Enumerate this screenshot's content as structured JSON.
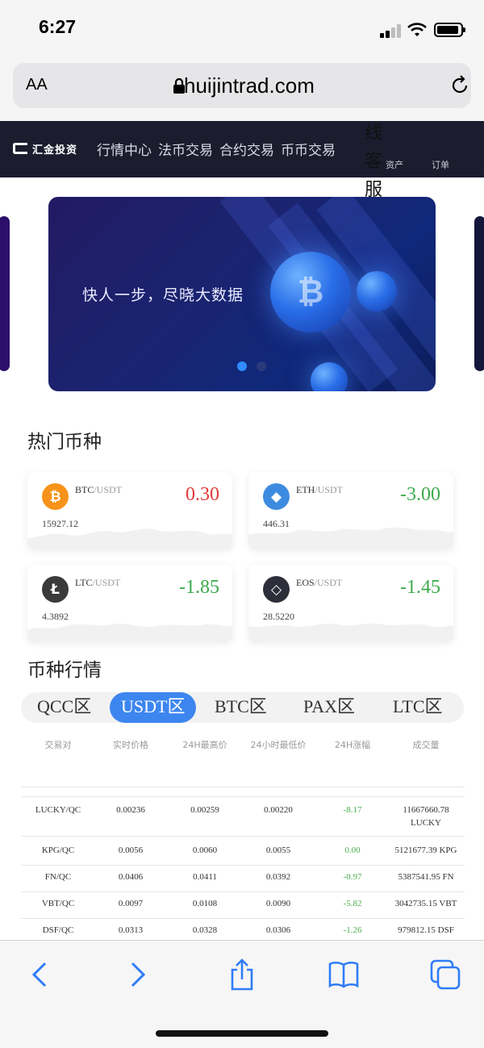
{
  "status_bar": {
    "time": "6:27"
  },
  "browser": {
    "text_size_label": "AA",
    "url": "huijintrad.com"
  },
  "site_header": {
    "logo_text": "汇金投资",
    "nav": [
      "行情中心",
      "法币交易",
      "合约交易",
      "币币交易"
    ],
    "nav_overflow_chars": [
      "线",
      "客",
      "服"
    ],
    "assets_label": "资产",
    "orders_label": "订单"
  },
  "banner": {
    "slogan": "快人一步，尽晓大数据",
    "slide_count": 2,
    "active_slide": 1
  },
  "hot": {
    "title": "热门币种",
    "cards": [
      {
        "base": "BTC",
        "quote": "/USDT",
        "change": "0.30",
        "price": "15927.12",
        "trend": "up",
        "icon": "bitcoin-icon",
        "icon_color": "#f7931a",
        "glyph": "₿"
      },
      {
        "base": "ETH",
        "quote": "/USDT",
        "change": "-3.00",
        "price": "446.31",
        "trend": "down",
        "icon": "ethereum-icon",
        "icon_color": "#3d8be0",
        "glyph": "◆"
      },
      {
        "base": "LTC",
        "quote": "/USDT",
        "change": "-1.85",
        "price": "4.3892",
        "trend": "down",
        "icon": "litecoin-icon",
        "icon_color": "#3a3a3a",
        "glyph": "Ł"
      },
      {
        "base": "EOS",
        "quote": "/USDT",
        "change": "-1.45",
        "price": "28.5220",
        "trend": "down",
        "icon": "eos-icon",
        "icon_color": "#2e2e3a",
        "glyph": "◇"
      }
    ]
  },
  "market": {
    "title": "币种行情",
    "tabs": [
      "QCC区",
      "USDT区",
      "BTC区",
      "PAX区",
      "LTC区"
    ],
    "active_tab": "USDT区",
    "columns": [
      "交易对",
      "实时价格",
      "24H最高价",
      "24小时最低价",
      "24H涨幅",
      "成交量"
    ],
    "rows": [
      {
        "pair": "LUCKY/QC",
        "price": "0.00236",
        "high": "0.00259",
        "low": "0.00220",
        "change": "-8.17",
        "volume": "11667660.78 LUCKY"
      },
      {
        "pair": "KPG/QC",
        "price": "0.0056",
        "high": "0.0060",
        "low": "0.0055",
        "change": "0.00",
        "volume": "5121677.39 KPG"
      },
      {
        "pair": "FN/QC",
        "price": "0.0406",
        "high": "0.0411",
        "low": "0.0392",
        "change": "-0.97",
        "volume": "5387541.95 FN"
      },
      {
        "pair": "VBT/QC",
        "price": "0.0097",
        "high": "0.0108",
        "low": "0.0090",
        "change": "-5.82",
        "volume": "3042735.15 VBT"
      },
      {
        "pair": "DSF/QC",
        "price": "0.0313",
        "high": "0.0328",
        "low": "0.0306",
        "change": "-1.26",
        "volume": "979812.15 DSF"
      }
    ]
  },
  "colors": {
    "accent": "#3d86f0",
    "up": "#e23a3a",
    "down": "#3daa4c",
    "header_bg": "#1b1d2e"
  },
  "toolbar_icons": [
    "back-icon",
    "forward-icon",
    "share-icon",
    "bookmarks-icon",
    "tabs-icon"
  ]
}
